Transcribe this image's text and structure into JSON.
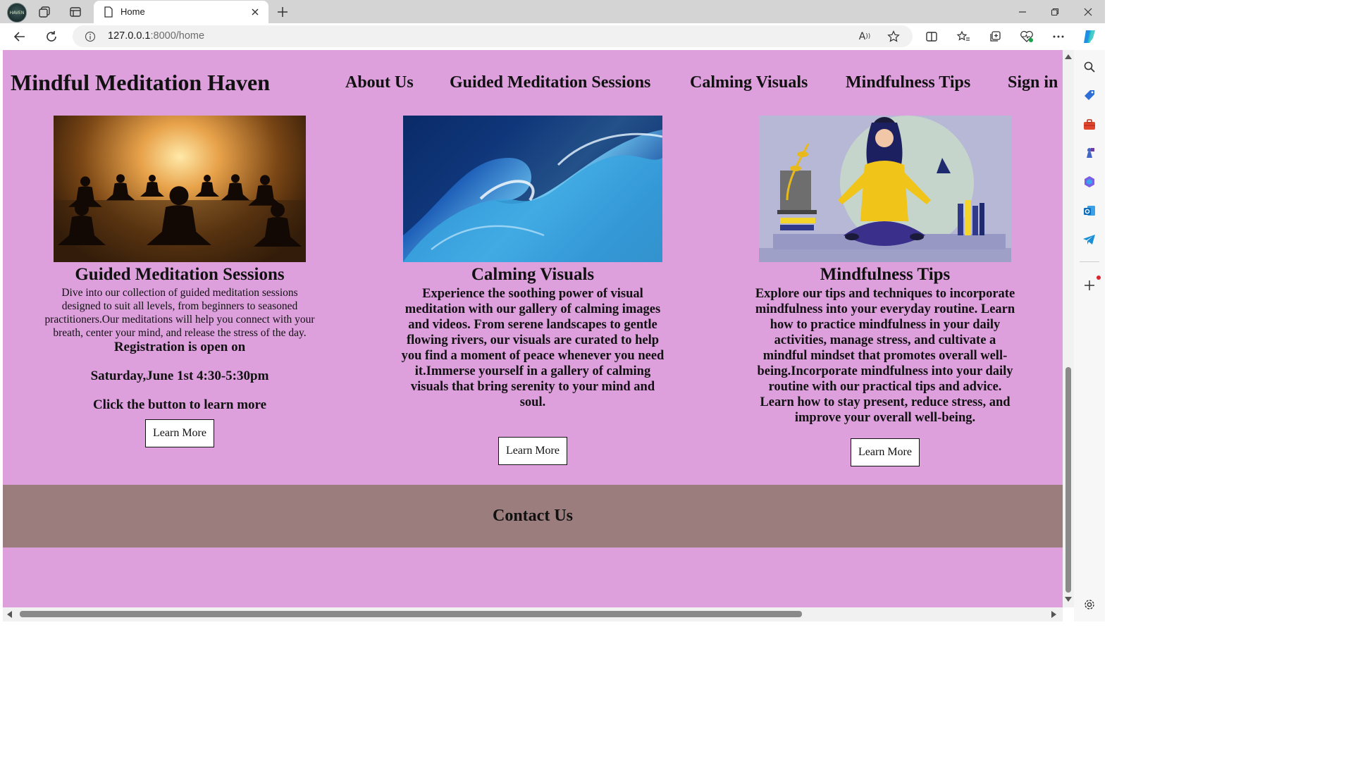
{
  "browser": {
    "tab_title": "Home",
    "url_host": "127.0.0.1",
    "url_path": ":8000/home",
    "profile_label": "HAVEN"
  },
  "site": {
    "title": "Mindful Meditation Haven",
    "nav": [
      "About Us",
      "Guided Meditation Sessions",
      "Calming Visuals",
      "Mindfulness Tips",
      "Sign in"
    ]
  },
  "cards": [
    {
      "heading": "Guided Meditation Sessions",
      "description": "Dive into our collection of guided meditation sessions designed to suit all levels, from beginners to seasoned practitioners.Our meditations will help you connect with your breath, center your mind, and release the stress of the day.",
      "registration": "Registration is open on",
      "date": "Saturday,June 1st 4:30-5:30pm",
      "cta_text": "Click the button to learn more",
      "button": "Learn More"
    },
    {
      "heading": "Calming Visuals",
      "description": "Experience the soothing power of visual meditation with our gallery of calming images and videos. From serene landscapes to gentle flowing rivers, our visuals are curated to help you find a moment of peace whenever you need it.Immerse yourself in a gallery of calming visuals that bring serenity to your mind and soul.",
      "button": "Learn More"
    },
    {
      "heading": "Mindfulness Tips",
      "description": "Explore our tips and techniques to incorporate mindfulness into your everyday routine. Learn how to practice mindfulness in your daily activities, manage stress, and cultivate a mindful mindset that promotes overall well-being.Incorporate mindfulness into your daily routine with our practical tips and advice. Learn how to stay present, reduce stress, and improve your overall well-being.",
      "button": "Learn More"
    }
  ],
  "footer": {
    "heading": "Contact Us"
  },
  "colors": {
    "page_bg": "#dda0dd",
    "footer_bg": "#9b7d7d",
    "button_bg": "#ffffff"
  },
  "icons": {
    "tabbar": [
      "workspaces-icon",
      "tab-actions-icon",
      "page-icon",
      "close-icon",
      "new-tab-icon",
      "minimize-icon",
      "restore-icon",
      "window-close-icon"
    ],
    "toolbar": [
      "back-icon",
      "refresh-icon",
      "info-icon",
      "read-aloud-icon",
      "favorite-star-icon",
      "split-screen-icon",
      "favorites-icon",
      "collections-icon",
      "browser-essentials-icon",
      "more-icon",
      "copilot-icon"
    ],
    "sidebar": [
      "search-icon",
      "shopping-icon",
      "tools-icon",
      "games-icon",
      "microsoft-365-icon",
      "outlook-icon",
      "telegram-icon",
      "add-icon",
      "settings-icon"
    ]
  }
}
